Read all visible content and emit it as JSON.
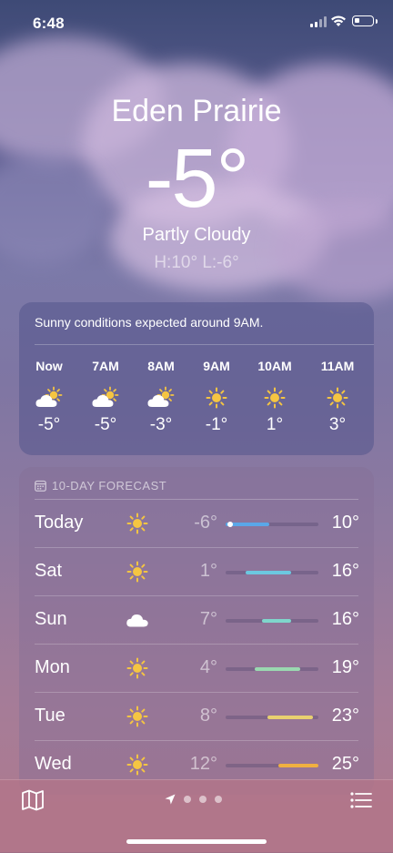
{
  "status_bar": {
    "time": "6:48"
  },
  "location": {
    "city": "Eden Prairie",
    "temperature": "-5°",
    "condition": "Partly Cloudy",
    "high_low": "H:10°  L:-6°"
  },
  "hourly": {
    "summary": "Sunny conditions expected around 9AM.",
    "hours": [
      {
        "label": "Now",
        "icon": "partly-sunny-icon",
        "temp": "-5°"
      },
      {
        "label": "7AM",
        "icon": "partly-sunny-icon",
        "temp": "-5°"
      },
      {
        "label": "8AM",
        "icon": "partly-sunny-icon",
        "temp": "-3°"
      },
      {
        "label": "9AM",
        "icon": "sun-icon",
        "temp": "-1°"
      },
      {
        "label": "10AM",
        "icon": "sun-icon",
        "temp": "1°"
      },
      {
        "label": "11AM",
        "icon": "sun-icon",
        "temp": "3°"
      }
    ]
  },
  "daily": {
    "title": "10-DAY FORECAST",
    "days": [
      {
        "name": "Today",
        "icon": "sun-icon",
        "low": "-6°",
        "high": "10°",
        "color": "#5aa7e8",
        "current": true
      },
      {
        "name": "Sat",
        "icon": "sun-icon",
        "low": "1°",
        "high": "16°",
        "color": "#6cc8e0"
      },
      {
        "name": "Sun",
        "icon": "cloud-icon",
        "low": "7°",
        "high": "16°",
        "color": "#7fd6cc"
      },
      {
        "name": "Mon",
        "icon": "sun-icon",
        "low": "4°",
        "high": "19°",
        "color": "#9ad8b0"
      },
      {
        "name": "Tue",
        "icon": "sun-icon",
        "low": "8°",
        "high": "23°",
        "color": "#e8d070"
      },
      {
        "name": "Wed",
        "icon": "sun-icon",
        "low": "12°",
        "high": "25°",
        "color": "#f0b040"
      }
    ]
  },
  "colors": {
    "sun": "#f5c542",
    "cloud": "#ffffff"
  },
  "bottom_bar": {
    "pages": 3
  }
}
